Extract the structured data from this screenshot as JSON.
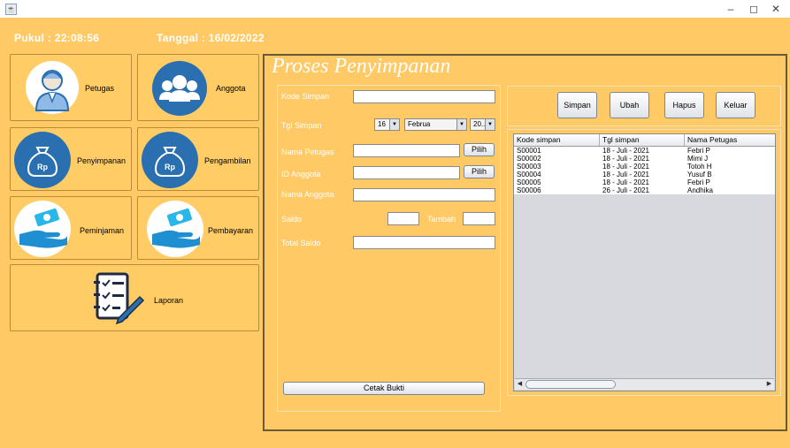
{
  "window": {
    "minimize_glyph": "–",
    "maximize_glyph": "◻",
    "close_glyph": "✕"
  },
  "header": {
    "clock_label": "Pukul : 22:08:56",
    "date_label": "Tanggal : 16/02/2022"
  },
  "nav": {
    "petugas": "Petugas",
    "anggota": "Anggota",
    "penyimpanan": "Penyimpanan",
    "pengambilan": "Pengambilan",
    "peminjaman": "Peminjaman",
    "pembayaran": "Pembayaran",
    "laporan": "Laporan"
  },
  "icons": {
    "petugas": "officer-icon",
    "anggota": "group-icon",
    "penyimpanan": "money-bag-icon",
    "pengambilan": "money-bag-icon",
    "peminjaman": "hand-money-icon",
    "pembayaran": "hand-money-icon",
    "laporan": "checklist-pen-icon"
  },
  "form": {
    "title": "Proses Penyimpanan",
    "kode_simpan_label": "Kode Simpan",
    "tgl_simpan_label": "Tgl Simpan",
    "tgl_day": "16",
    "tgl_month": "Februa",
    "tgl_year": "20...",
    "nama_petugas_label": "Nama Petugas",
    "id_anggota_label": "ID Anggota",
    "nama_anggota_label": "Nama Anggota",
    "saldo_label": "Saldo",
    "tambah_label": "Tambah",
    "total_saldo_label": "Total Saldo",
    "pilih_label": "Pilih",
    "cetak_label": "Cetak Bukti"
  },
  "actions": {
    "simpan": "Simpan",
    "ubah": "Ubah",
    "hapus": "Hapus",
    "keluar": "Keluar"
  },
  "table": {
    "headers": [
      "Kode simpan",
      "Tgl simpan",
      "Nama Petugas"
    ],
    "rows": [
      [
        "S00001",
        "18 - Juli - 2021",
        "Febri P"
      ],
      [
        "S00002",
        "18 - Juli - 2021",
        "Mimi J"
      ],
      [
        "S00003",
        "18 - Juli - 2021",
        "Totoh H"
      ],
      [
        "S00004",
        "18 - Juli - 2021",
        "Yusuf B"
      ],
      [
        "S00005",
        "18 - Juli - 2021",
        "Febri P"
      ],
      [
        "S00006",
        "26 - Juli - 2021",
        "Andhika"
      ]
    ]
  },
  "colors": {
    "background": "#FFC966",
    "nav_button": "#FFCC66",
    "icon_blue": "#2A6FB0",
    "table_bg": "#D8D8DF",
    "label_text": "#FFFFFF"
  }
}
